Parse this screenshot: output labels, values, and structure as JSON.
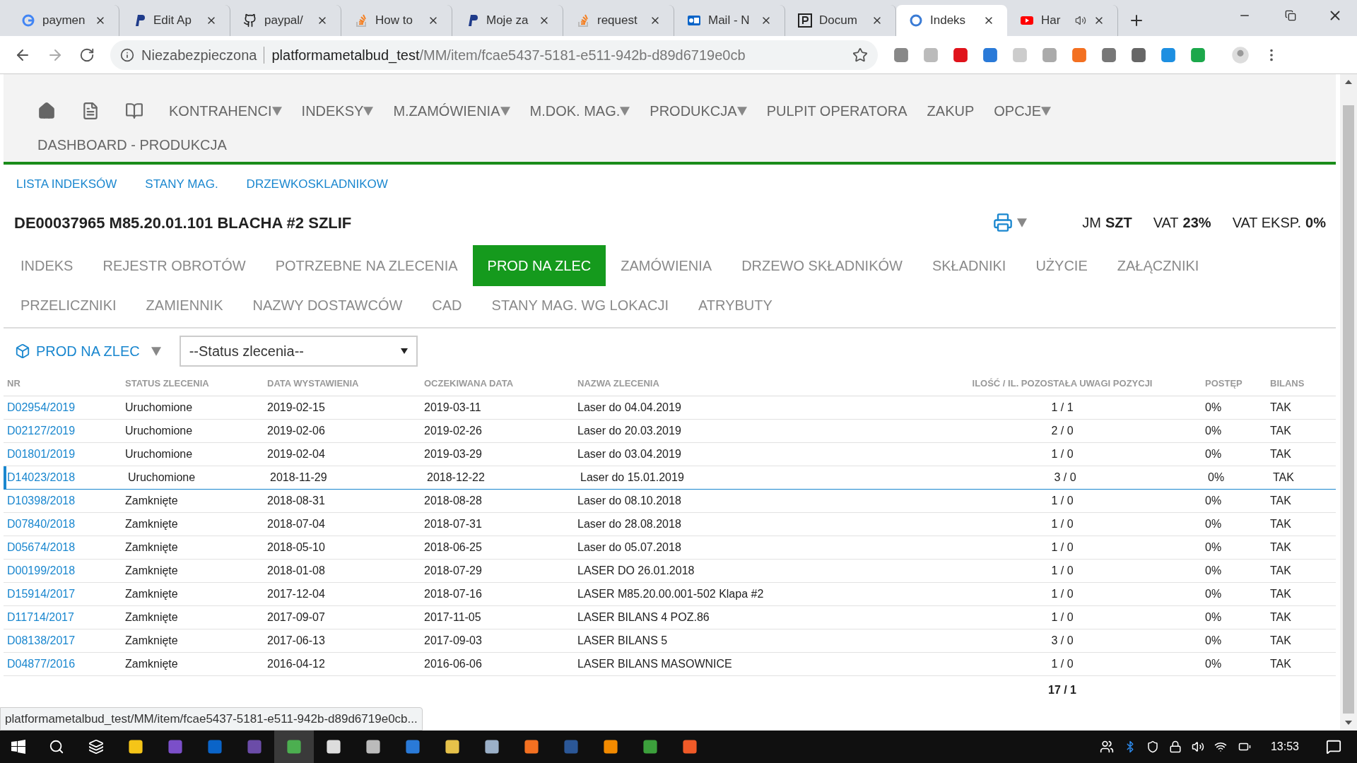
{
  "browser_tabs": [
    {
      "title": "paymen",
      "kind": "g",
      "selected": false,
      "audio": false
    },
    {
      "title": "Edit Ap",
      "kind": "p",
      "selected": false,
      "audio": false
    },
    {
      "title": "paypal/",
      "kind": "gh",
      "selected": false,
      "audio": false
    },
    {
      "title": "How to",
      "kind": "so",
      "selected": false,
      "audio": false
    },
    {
      "title": "Moje za",
      "kind": "p",
      "selected": false,
      "audio": false
    },
    {
      "title": "request",
      "kind": "so",
      "selected": false,
      "audio": false
    },
    {
      "title": "Mail - N",
      "kind": "mail",
      "selected": false,
      "audio": false
    },
    {
      "title": "Docum",
      "kind": "doc",
      "selected": false,
      "audio": false
    },
    {
      "title": "Indeks",
      "kind": "ring",
      "selected": true,
      "audio": false
    },
    {
      "title": "Har",
      "kind": "yt",
      "selected": false,
      "audio": true
    }
  ],
  "address_bar": {
    "security": "Niezabezpieczona",
    "host": "platformametalbud_test",
    "path": "/MM/item/fcae5437-5181-e511-942b-d89d6719e0cb"
  },
  "nav": {
    "items": [
      {
        "label": "KONTRAHENCI",
        "has_menu": true
      },
      {
        "label": "INDEKSY",
        "has_menu": true
      },
      {
        "label": "M.ZAMÓWIENIA",
        "has_menu": true
      },
      {
        "label": "M.DOK. MAG.",
        "has_menu": true
      },
      {
        "label": "PRODUKCJA",
        "has_menu": true
      },
      {
        "label": "PULPIT OPERATORA",
        "has_menu": false
      },
      {
        "label": "ZAKUP",
        "has_menu": false
      },
      {
        "label": "OPCJE",
        "has_menu": true
      },
      {
        "label": "DASHBOARD - PRODUKCJA",
        "has_menu": false
      }
    ]
  },
  "sub_links": [
    "LISTA INDEKSÓW",
    "STANY MAG.",
    "DRZEWKOSKLADNIKOW"
  ],
  "item": {
    "title": "DE00037965 M85.20.01.101 BLACHA #2 SZLIF",
    "props": [
      {
        "label": "JM",
        "value": "SZT"
      },
      {
        "label": "VAT",
        "value": "23%"
      },
      {
        "label": "VAT EKSP.",
        "value": "0%"
      }
    ]
  },
  "tabs": [
    {
      "label": "INDEKS",
      "selected": false
    },
    {
      "label": "REJESTR OBROTÓW",
      "selected": false
    },
    {
      "label": "POTRZEBNE NA ZLECENIA",
      "selected": false
    },
    {
      "label": "PROD NA ZLEC",
      "selected": true
    },
    {
      "label": "ZAMÓWIENIA",
      "selected": false
    },
    {
      "label": "DRZEWO SKŁADNIKÓW",
      "selected": false
    },
    {
      "label": "SKŁADNIKI",
      "selected": false
    },
    {
      "label": "UŻYCIE",
      "selected": false
    },
    {
      "label": "ZAŁĄCZNIKI",
      "selected": false
    },
    {
      "label": "PRZELICZNIKI",
      "selected": false
    },
    {
      "label": "ZAMIENNIK",
      "selected": false
    },
    {
      "label": "NAZWY DOSTAWCÓW",
      "selected": false
    },
    {
      "label": "CAD",
      "selected": false
    },
    {
      "label": "STANY MAG. WG LOKACJI",
      "selected": false
    },
    {
      "label": "ATRYBUTY",
      "selected": false
    }
  ],
  "filter": {
    "label": "PROD NA ZLEC",
    "select_value": "--Status zlecenia--"
  },
  "table": {
    "columns": [
      "NR",
      "STATUS ZLECENIA",
      "DATA WYSTAWIENIA",
      "OCZEKIWANA DATA",
      "NAZWA ZLECENIA",
      "ILOŚĆ / IL. POZOSTAŁA UWAGI POZYCJI",
      "POSTĘP",
      "BILANS"
    ],
    "rows": [
      {
        "cells": [
          "D02954/2019",
          "Uruchomione",
          "2019-02-15",
          "2019-03-11",
          "Laser do 04.04.2019",
          "1 / 1",
          "0%",
          "TAK"
        ],
        "selected": false
      },
      {
        "cells": [
          "D02127/2019",
          "Uruchomione",
          "2019-02-06",
          "2019-02-26",
          "Laser do 20.03.2019",
          "2 / 0",
          "0%",
          "TAK"
        ],
        "selected": false
      },
      {
        "cells": [
          "D01801/2019",
          "Uruchomione",
          "2019-02-04",
          "2019-03-29",
          "Laser do 03.04.2019",
          "1 / 0",
          "0%",
          "TAK"
        ],
        "selected": false
      },
      {
        "cells": [
          "D14023/2018",
          "Uruchomione",
          "2018-11-29",
          "2018-12-22",
          "Laser do 15.01.2019",
          "3 / 0",
          "0%",
          "TAK"
        ],
        "selected": true
      },
      {
        "cells": [
          "D10398/2018",
          "Zamknięte",
          "2018-08-31",
          "2018-08-28",
          "Laser do 08.10.2018",
          "1 / 0",
          "0%",
          "TAK"
        ],
        "selected": false
      },
      {
        "cells": [
          "D07840/2018",
          "Zamknięte",
          "2018-07-04",
          "2018-07-31",
          "Laser do 28.08.2018",
          "1 / 0",
          "0%",
          "TAK"
        ],
        "selected": false
      },
      {
        "cells": [
          "D05674/2018",
          "Zamknięte",
          "2018-05-10",
          "2018-06-25",
          "Laser do 05.07.2018",
          "1 / 0",
          "0%",
          "TAK"
        ],
        "selected": false
      },
      {
        "cells": [
          "D00199/2018",
          "Zamknięte",
          "2018-01-08",
          "2018-07-29",
          "LASER DO 26.01.2018",
          "1 / 0",
          "0%",
          "TAK"
        ],
        "selected": false
      },
      {
        "cells": [
          "D15914/2017",
          "Zamknięte",
          "2017-12-04",
          "2018-07-16",
          "LASER M85.20.00.001-502 Klapa #2",
          "1 / 0",
          "0%",
          "TAK"
        ],
        "selected": false
      },
      {
        "cells": [
          "D11714/2017",
          "Zamknięte",
          "2017-09-07",
          "2017-11-05",
          "LASER BILANS 4 POZ.86",
          "1 / 0",
          "0%",
          "TAK"
        ],
        "selected": false
      },
      {
        "cells": [
          "D08138/2017",
          "Zamknięte",
          "2017-06-13",
          "2017-09-03",
          "LASER BILANS 5",
          "3 / 0",
          "0%",
          "TAK"
        ],
        "selected": false
      },
      {
        "cells": [
          "D04877/2016",
          "Zamknięte",
          "2016-04-12",
          "2016-06-06",
          "LASER BILANS MASOWNICE",
          "1 / 0",
          "0%",
          "TAK"
        ],
        "selected": false
      }
    ],
    "total": "17 / 1"
  },
  "status_url": "platformametalbud_test/MM/item/fcae5437-5181-e511-942b-d89d6719e0cb...",
  "taskbar": {
    "clock": "13:53"
  }
}
